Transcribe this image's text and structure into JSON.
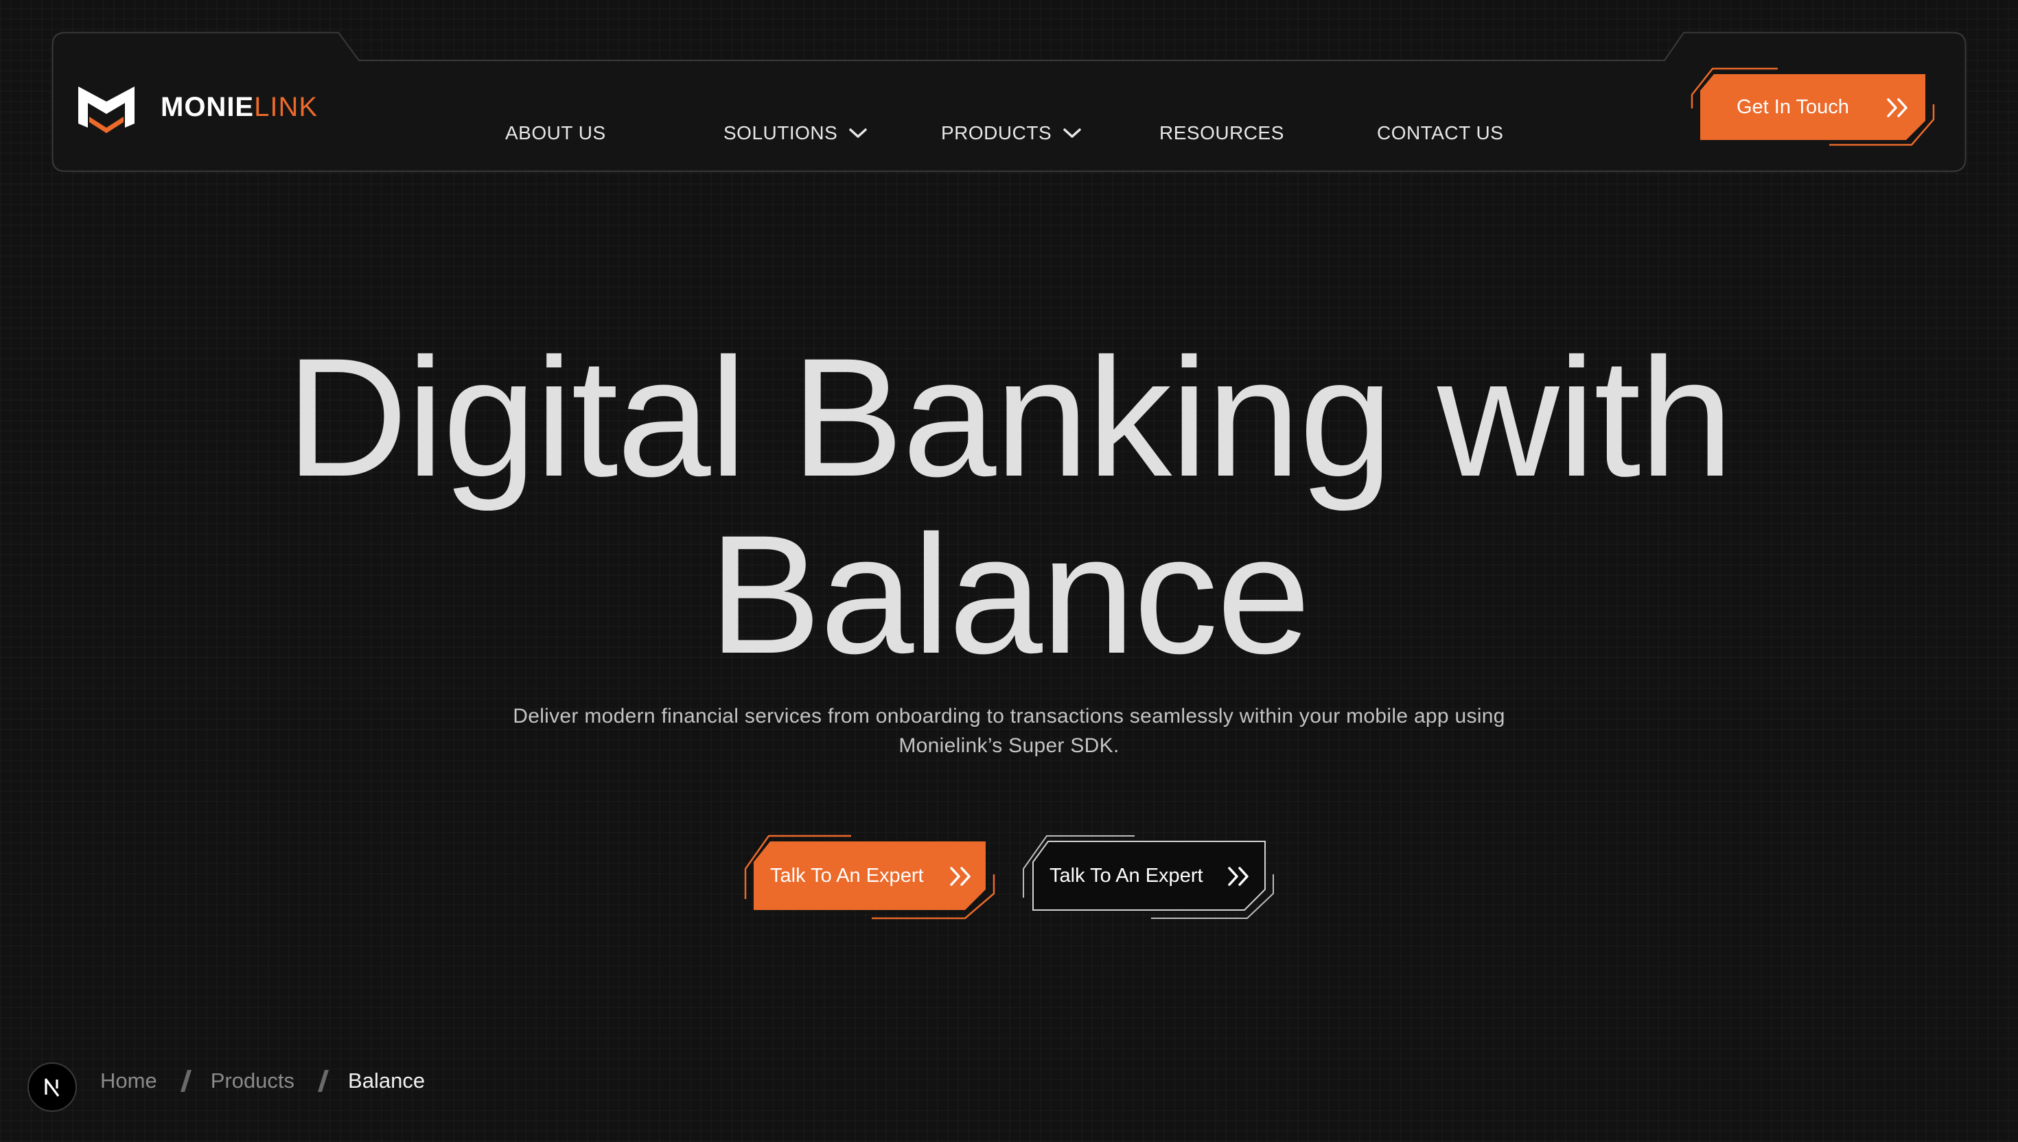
{
  "brand": {
    "name_part1": "MONIE",
    "name_part2": "LINK",
    "accent_color": "#ec6a2a"
  },
  "nav": {
    "items": [
      {
        "label": "ABOUT US",
        "has_dropdown": false
      },
      {
        "label": "SOLUTIONS",
        "has_dropdown": true
      },
      {
        "label": "PRODUCTS",
        "has_dropdown": true
      },
      {
        "label": "RESOURCES",
        "has_dropdown": false
      },
      {
        "label": "CONTACT US",
        "has_dropdown": false
      }
    ],
    "cta_label": "Get In Touch",
    "cta_icon": "double-chevron-right-icon"
  },
  "hero": {
    "title_line1": "Digital Banking with",
    "title_line2": "Balance",
    "subtitle_line1": "Deliver modern financial services from onboarding to transactions seamlessly within your mobile app using",
    "subtitle_line2": "Monielink’s Super SDK.",
    "primary_button": "Talk To An Expert",
    "secondary_button": "Talk To An Expert"
  },
  "breadcrumb": {
    "items": [
      "Home",
      "Products",
      "Balance"
    ]
  },
  "dev_badge": {
    "letter": "N"
  }
}
